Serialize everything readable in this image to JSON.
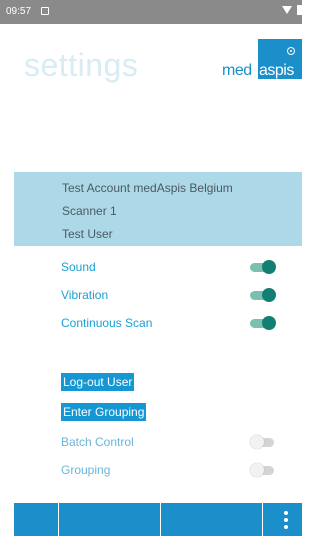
{
  "status_bar": {
    "time": "09:57",
    "icons": [
      "notification-icon",
      "wifi-icon",
      "battery-icon"
    ]
  },
  "header": {
    "title": "settings",
    "logo": {
      "text_left": "med",
      "text_right": "aspis",
      "colors": {
        "brand": "#1a8fc9"
      }
    }
  },
  "account": {
    "lines": [
      "Test Account medAspis Belgium",
      "Scanner 1",
      "Test User"
    ]
  },
  "toggles": [
    {
      "label": "Sound",
      "on": true
    },
    {
      "label": "Vibration",
      "on": true
    },
    {
      "label": "Continuous Scan",
      "on": true
    },
    {
      "label": "Batch Control",
      "on": false
    },
    {
      "label": "Grouping",
      "on": false
    }
  ],
  "buttons": {
    "logout": "Log-out User",
    "grouping": "Enter Grouping"
  },
  "bottom_nav": {
    "items": [
      "nav-tab-1",
      "nav-tab-2",
      "nav-tab-3",
      "nav-tab-4"
    ],
    "menu_icon": "more-vert-icon"
  },
  "colors": {
    "accent": "#1a8fc9",
    "panel": "#add8e8",
    "toggle_on": "#137f72",
    "label": "#1aa0d6"
  }
}
